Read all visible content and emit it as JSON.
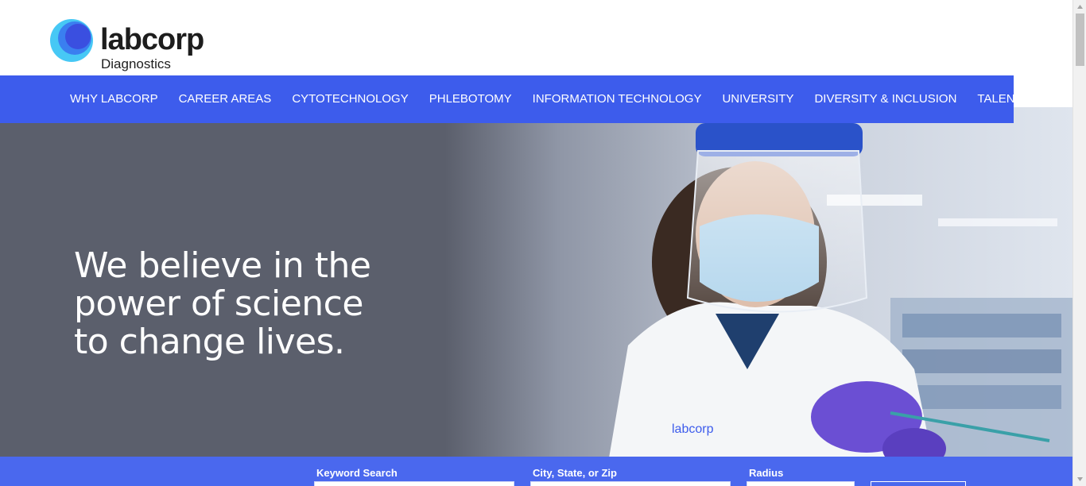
{
  "brand": {
    "name": "labcorp",
    "division": "Diagnostics",
    "colors": {
      "primary_blue": "#3d5cec",
      "logo_light": "#47c8f5",
      "logo_dark": "#3a4fe0"
    }
  },
  "nav": {
    "items": [
      {
        "label": "WHY LABCORP"
      },
      {
        "label": "CAREER AREAS"
      },
      {
        "label": "CYTOTECHNOLOGY"
      },
      {
        "label": "PHLEBOTOMY"
      },
      {
        "label": "INFORMATION TECHNOLOGY"
      },
      {
        "label": "UNIVERSITY"
      },
      {
        "label": "DIVERSITY & INCLUSION"
      },
      {
        "label": "TALENT COMMUNITY"
      }
    ]
  },
  "hero": {
    "headline": "We believe in the power of science to change lives."
  },
  "search": {
    "keyword_label": "Keyword Search",
    "location_label": "City, State, or Zip",
    "radius_label": "Radius"
  }
}
